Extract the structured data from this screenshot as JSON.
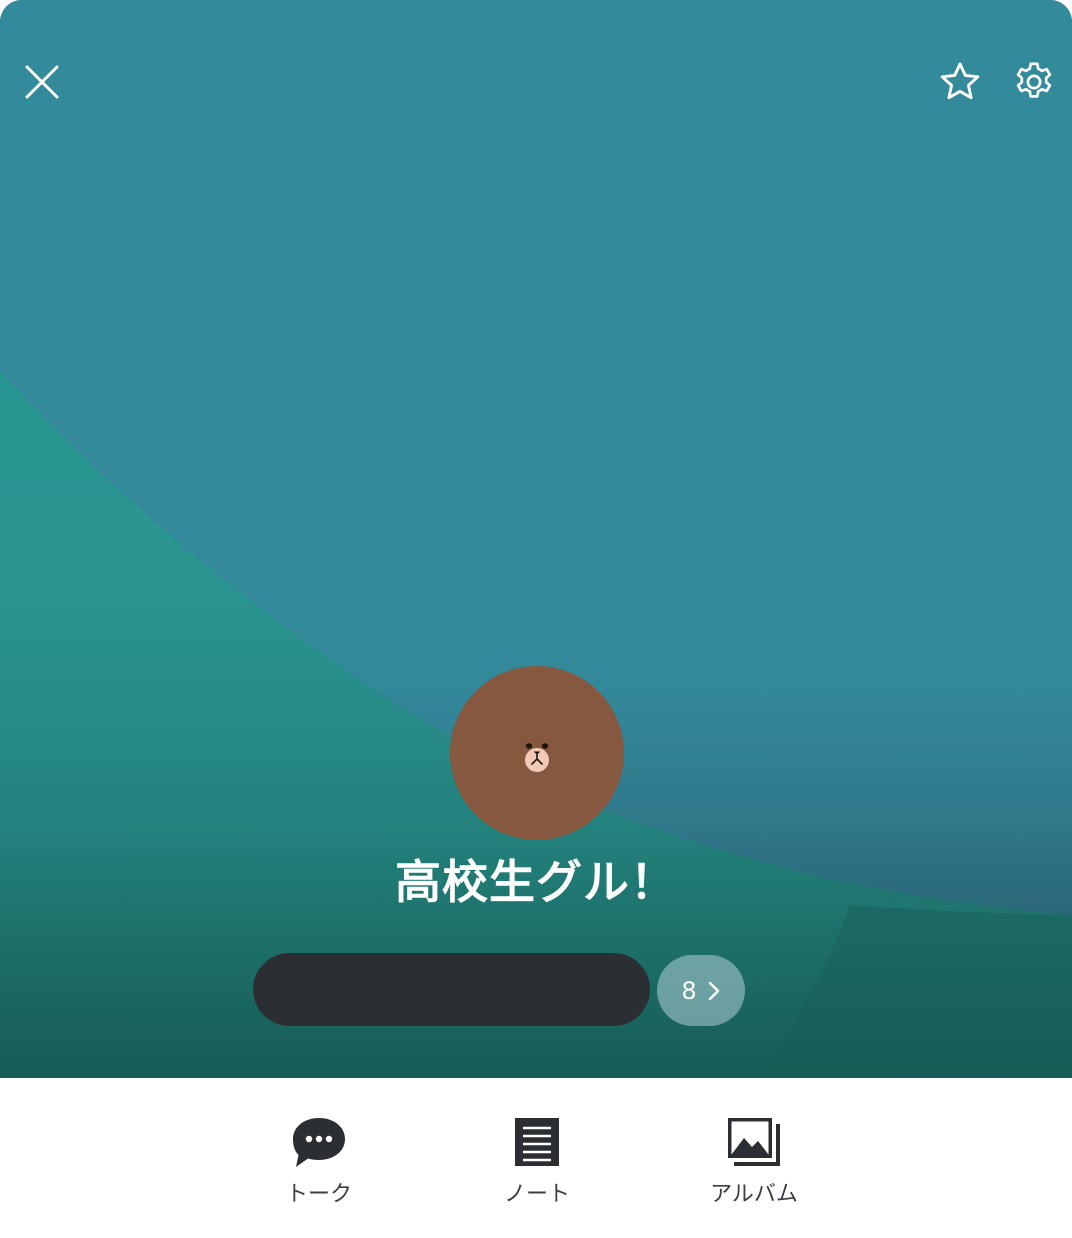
{
  "header": {
    "close_icon": "close-icon",
    "favorite_icon": "star-icon",
    "settings_icon": "gear-icon"
  },
  "group": {
    "name": "高校生グル！",
    "avatar_icon": "brown-bear-avatar",
    "member_count": "8"
  },
  "menu": [
    {
      "label": "トーク",
      "icon": "chat-bubble-icon"
    },
    {
      "label": "ノート",
      "icon": "note-icon"
    },
    {
      "label": "アルバム",
      "icon": "album-icon"
    }
  ],
  "colors": {
    "cover_base": "#338a9a",
    "cover_accent": "#2b9896",
    "cover_dark": "#1b6e66",
    "avatar_bg": "#85583f",
    "members_bar": "#2b2f33",
    "menu_icon": "#2b2f33",
    "menu_text": "#3b3f44"
  }
}
